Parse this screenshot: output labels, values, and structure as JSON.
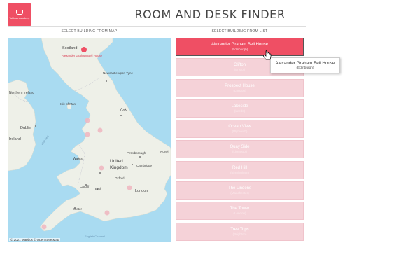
{
  "logo": {
    "text": "Tableau Academy"
  },
  "header": {
    "title": "ROOM AND DESK FINDER"
  },
  "map_panel": {
    "label": "SELECT BUILDING FROM MAP",
    "attribution": "© 2021 Mapbox © OpenStreetMap",
    "place_labels": {
      "scotland": "Scotland",
      "marker_label": "Alexander Graham Bell House",
      "newcastle": "Newcastle upon Tyne",
      "northern_ireland": "Northern Ireland",
      "isle_of_man": "Isle of Man",
      "york": "York",
      "dublin": "Dublin",
      "ireland": "Ireland",
      "irish_sea": "Irish Sea",
      "peterborough": "Peterborough",
      "norwich": "Norwi",
      "wales": "Wales",
      "united_kingdom_1": "United",
      "united_kingdom_2": "Kingdom",
      "cambridge": "Cambridge",
      "oxford": "Oxford",
      "cardiff": "Cardiff",
      "bath": "Bath",
      "london": "London",
      "exeter": "Exeter",
      "english_channel": "English Channel"
    }
  },
  "list_panel": {
    "label": "SELECT BUILDING FROM LIST",
    "buildings": [
      {
        "name": "Alexander Graham Bell House",
        "location": "(Edinburgh)"
      },
      {
        "name": "Clifton",
        "location": "(Bristol)"
      },
      {
        "name": "Prospect House",
        "location": "(London)"
      },
      {
        "name": "Lakeside",
        "location": "(Leeds)"
      },
      {
        "name": "Ocean View",
        "location": "(Plymouth)"
      },
      {
        "name": "Quay Side",
        "location": "(Liverpool)"
      },
      {
        "name": "Red Hill",
        "location": "(Birmingham)"
      },
      {
        "name": "The Lindens",
        "location": "(Manchester)"
      },
      {
        "name": "The Tower",
        "location": "(London)"
      },
      {
        "name": "Tree Tops",
        "location": "(Brighton)"
      }
    ]
  },
  "tooltip": {
    "name": "Alexander Graham Bell House",
    "location": "(Edinburgh)"
  },
  "colors": {
    "accent": "#ef4f64",
    "list_inactive": "#f5d2d8",
    "water": "#a9dbf1",
    "land": "#eef0e8"
  }
}
